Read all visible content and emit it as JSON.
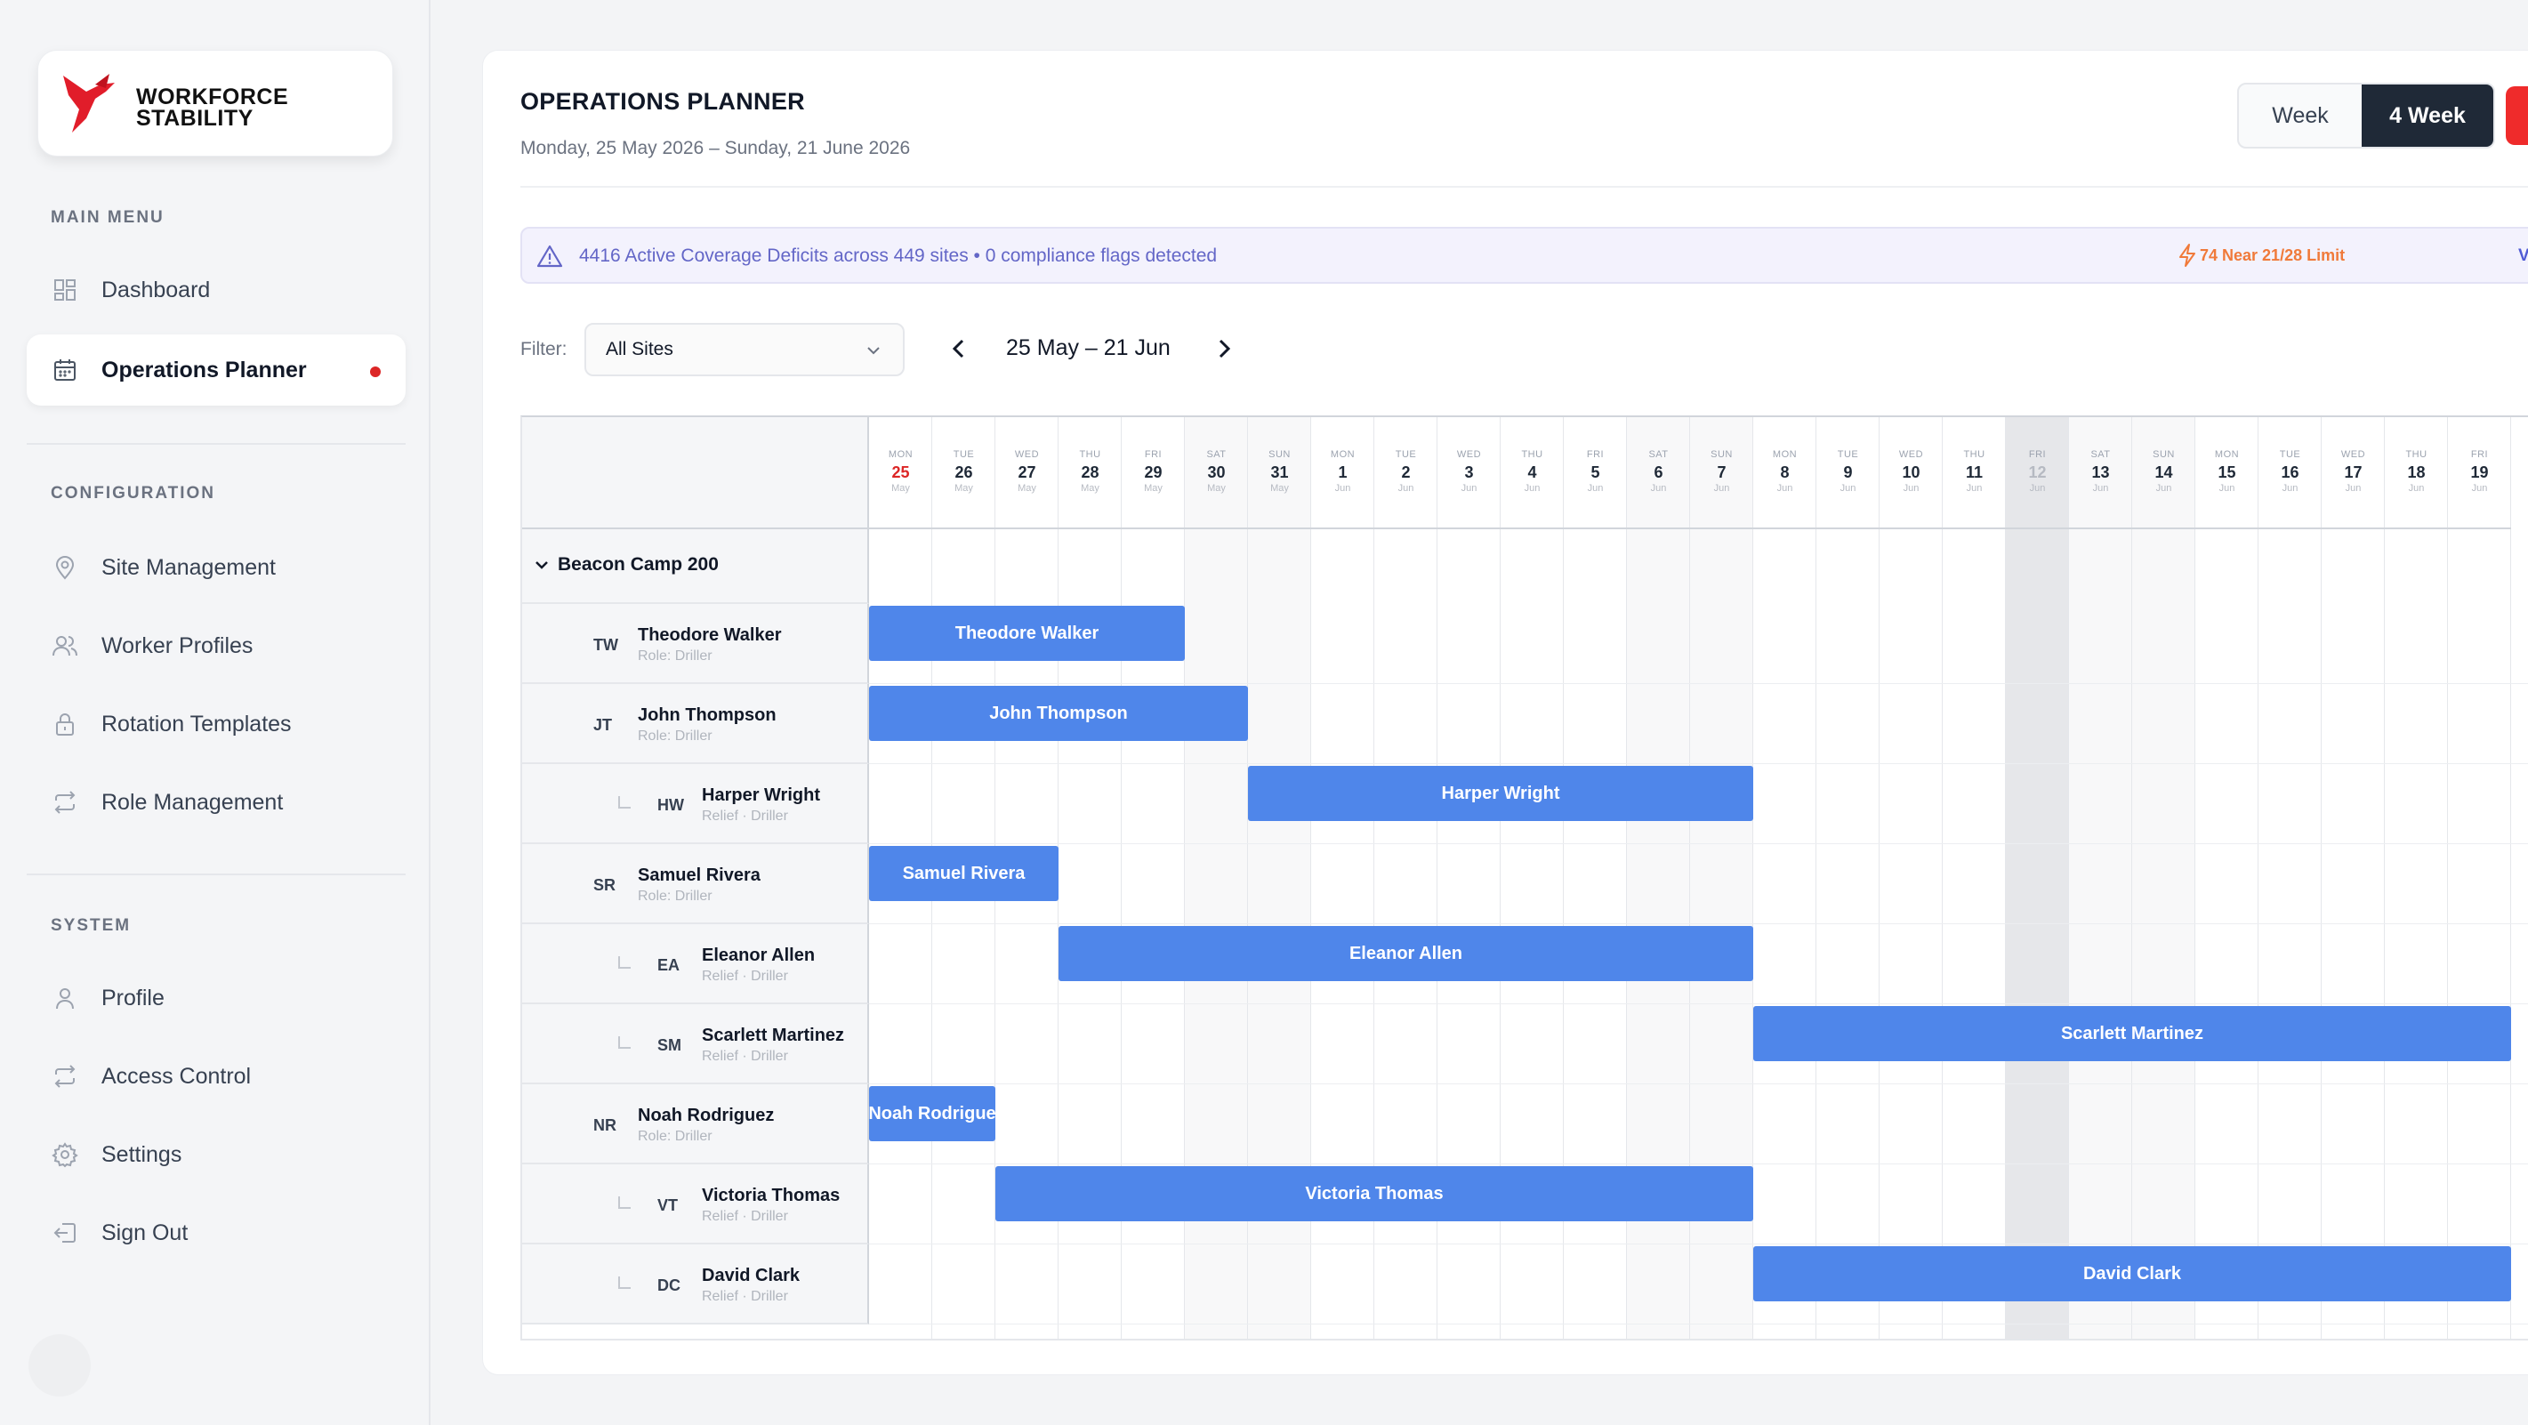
{
  "brand": {
    "line1": "WORKFORCE",
    "line2": "STABILITY",
    "accent": "#e11d2a"
  },
  "sidebar": {
    "main_title": "MAIN MENU",
    "main_items": [
      {
        "label": "Dashboard",
        "icon": "grid-icon"
      },
      {
        "label": "Operations Planner",
        "icon": "calendar-icon",
        "active": true
      }
    ],
    "config_title": "CONFIGURATION",
    "config_items": [
      {
        "label": "Site Management",
        "icon": "map-pin-icon"
      },
      {
        "label": "Worker Profiles",
        "icon": "users-icon"
      },
      {
        "label": "Rotation Templates",
        "icon": "lock-icon"
      },
      {
        "label": "Role Management",
        "icon": "repeat-icon"
      }
    ],
    "system_title": "SYSTEM",
    "system_items": [
      {
        "label": "Profile",
        "icon": "user-icon"
      },
      {
        "label": "Access Control",
        "icon": "repeat-icon"
      },
      {
        "label": "Settings",
        "icon": "gear-icon"
      },
      {
        "label": "Sign Out",
        "icon": "sign-out-icon"
      }
    ]
  },
  "header": {
    "title": "OPERATIONS PLANNER",
    "subtitle": "Monday, 25 May 2026 – Sunday, 21 June 2026",
    "view_week": "Week",
    "view_4week": "4 Week"
  },
  "alert": {
    "text": "4416 Active Coverage Deficits across 449 sites • 0 compliance flags detected",
    "flag": "74 Near 21/28 Limit",
    "view": "VIEW"
  },
  "filter": {
    "label": "Filter:",
    "value": "All Sites"
  },
  "range": "25 May – 21 Jun",
  "days": [
    {
      "dow": "MON",
      "num": "25",
      "mon": "May"
    },
    {
      "dow": "TUE",
      "num": "26",
      "mon": "May"
    },
    {
      "dow": "WED",
      "num": "27",
      "mon": "May"
    },
    {
      "dow": "THU",
      "num": "28",
      "mon": "May"
    },
    {
      "dow": "FRI",
      "num": "29",
      "mon": "May"
    },
    {
      "dow": "SAT",
      "num": "30",
      "mon": "May"
    },
    {
      "dow": "SUN",
      "num": "31",
      "mon": "May"
    },
    {
      "dow": "MON",
      "num": "1",
      "mon": "Jun"
    },
    {
      "dow": "TUE",
      "num": "2",
      "mon": "Jun"
    },
    {
      "dow": "WED",
      "num": "3",
      "mon": "Jun"
    },
    {
      "dow": "THU",
      "num": "4",
      "mon": "Jun"
    },
    {
      "dow": "FRI",
      "num": "5",
      "mon": "Jun"
    },
    {
      "dow": "SAT",
      "num": "6",
      "mon": "Jun"
    },
    {
      "dow": "SUN",
      "num": "7",
      "mon": "Jun"
    },
    {
      "dow": "MON",
      "num": "8",
      "mon": "Jun"
    },
    {
      "dow": "TUE",
      "num": "9",
      "mon": "Jun"
    },
    {
      "dow": "WED",
      "num": "10",
      "mon": "Jun"
    },
    {
      "dow": "THU",
      "num": "11",
      "mon": "Jun"
    },
    {
      "dow": "FRI",
      "num": "12",
      "mon": "Jun"
    },
    {
      "dow": "SAT",
      "num": "13",
      "mon": "Jun"
    },
    {
      "dow": "SUN",
      "num": "14",
      "mon": "Jun"
    },
    {
      "dow": "MON",
      "num": "15",
      "mon": "Jun"
    },
    {
      "dow": "TUE",
      "num": "16",
      "mon": "Jun"
    },
    {
      "dow": "WED",
      "num": "17",
      "mon": "Jun"
    },
    {
      "dow": "THU",
      "num": "18",
      "mon": "Jun"
    },
    {
      "dow": "FRI",
      "num": "19",
      "mon": "Jun"
    }
  ],
  "group": "Beacon Camp 200",
  "workers": [
    {
      "initials": "TW",
      "name": "Theodore Walker",
      "role": "Role: Driller",
      "relief": false,
      "bar": "Theodore Walker",
      "start": "25 May",
      "end": "29 May"
    },
    {
      "initials": "JT",
      "name": "John Thompson",
      "role": "Role: Driller",
      "relief": false,
      "bar": "John Thompson",
      "start": "25 May",
      "end": "30 May"
    },
    {
      "initials": "HW",
      "name": "Harper Wright",
      "role": "Relief · Driller",
      "relief": true,
      "bar": "Harper Wright",
      "start": "31 May",
      "end": "7 Jun"
    },
    {
      "initials": "SR",
      "name": "Samuel Rivera",
      "role": "Role: Driller",
      "relief": false,
      "bar": "Samuel Rivera",
      "start": "25 May",
      "end": "27 May"
    },
    {
      "initials": "EA",
      "name": "Eleanor Allen",
      "role": "Relief · Driller",
      "relief": true,
      "bar": "Eleanor Allen",
      "start": "28 May",
      "end": "7 Jun"
    },
    {
      "initials": "SM",
      "name": "Scarlett Martinez",
      "role": "Relief · Driller",
      "relief": true,
      "bar": "Scarlett Martinez",
      "start": "8 Jun",
      "end": "19 Jun"
    },
    {
      "initials": "NR",
      "name": "Noah Rodriguez",
      "role": "Role: Driller",
      "relief": false,
      "bar": "Noah Rodrigue",
      "start": "25 May",
      "end": "26 May"
    },
    {
      "initials": "VT",
      "name": "Victoria Thomas",
      "role": "Relief · Driller",
      "relief": true,
      "bar": "Victoria Thomas",
      "start": "27 May",
      "end": "7 Jun"
    },
    {
      "initials": "DC",
      "name": "David Clark",
      "role": "Relief · Driller",
      "relief": true,
      "bar": "David Clark",
      "start": "8 Jun",
      "end": "19 Jun"
    }
  ],
  "colors": {
    "bar": "#4f86ea",
    "today_col": "#e6e7ea",
    "primary_dark": "#1f2937",
    "danger": "#ef2b2b",
    "alert_text": "#6366c7",
    "warn": "#f07a3a"
  }
}
